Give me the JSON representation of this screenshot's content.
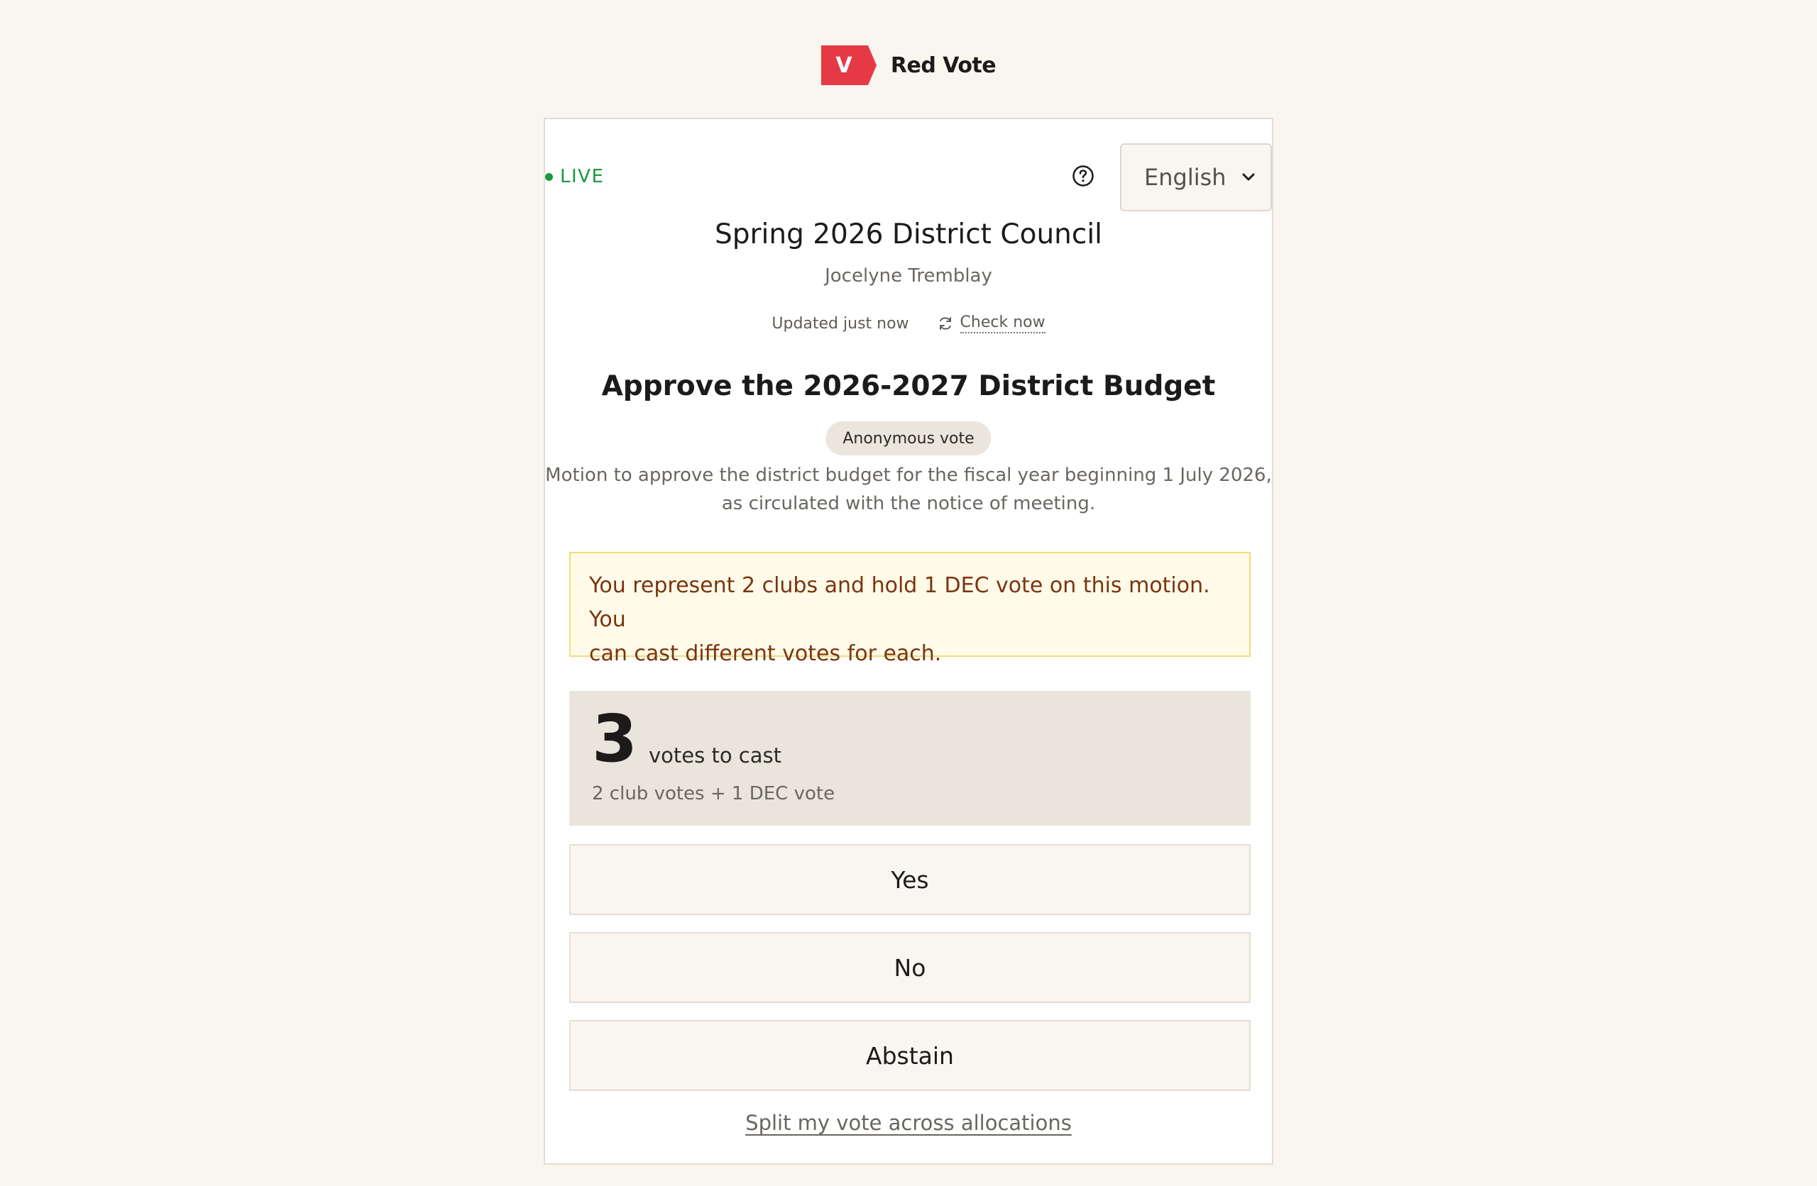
{
  "brand": {
    "logo_letter": "V",
    "name": "Red Vote",
    "accent_color": "#e63946"
  },
  "header": {
    "status": "LIVE",
    "status_color": "#17993f",
    "help_icon": "question-circle-icon",
    "language": {
      "selected": "English"
    }
  },
  "meeting": {
    "title": "Spring 2026 District Council",
    "organizer": "Jocelyne Tremblay",
    "updated_text": "Updated just now",
    "check_now_label": "Check now"
  },
  "motion": {
    "title": "Approve the 2026-2027 District Budget",
    "badge": "Anonymous vote",
    "description_line1": "Motion to approve the district budget for the fiscal year beginning 1 July 2026,",
    "description_line2": "as circulated with the notice of meeting."
  },
  "notice": {
    "line1": "You represent 2 clubs and hold 1 DEC vote on this motion. You",
    "line2": "can cast different votes for each."
  },
  "votes": {
    "count": "3",
    "label": "votes to cast",
    "breakdown": "2 club votes + 1 DEC vote"
  },
  "choices": {
    "yes": "Yes",
    "no": "No",
    "abstain": "Abstain"
  },
  "split_link": "Split my vote across allocations"
}
